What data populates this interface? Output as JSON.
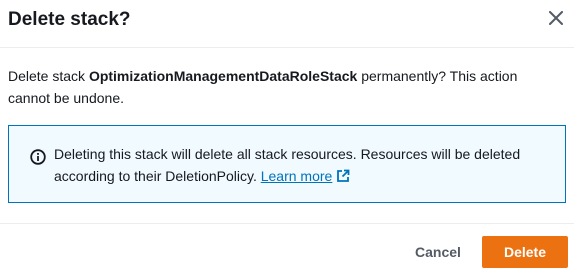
{
  "dialog": {
    "title": "Delete stack?",
    "close_icon": "close-icon"
  },
  "body": {
    "message_prefix": "Delete stack ",
    "stack_name": "OptimizationManagementDataRoleStack",
    "message_suffix": " permanently? This action cannot be undone."
  },
  "info_alert": {
    "icon": "info-icon",
    "text": "Deleting this stack will delete all stack resources. Resources will be deleted according to their DeletionPolicy.",
    "link_label": "Learn more",
    "link_icon": "external-link-icon",
    "border_color": "#0073bb",
    "background_color": "#f1faff"
  },
  "footer": {
    "cancel_label": "Cancel",
    "delete_label": "Delete",
    "primary_color": "#ec7211"
  }
}
